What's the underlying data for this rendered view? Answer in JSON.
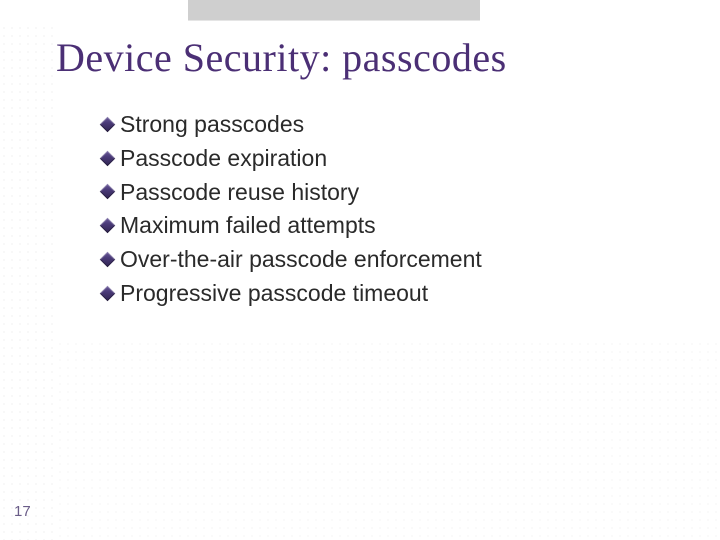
{
  "slide": {
    "title": "Device Security: passcodes",
    "bullets": [
      "Strong passcodes",
      "Passcode expiration",
      "Passcode reuse history",
      "Maximum failed attempts",
      "Over-the-air passcode enforcement",
      "Progressive passcode timeout"
    ],
    "page_number": "17"
  }
}
